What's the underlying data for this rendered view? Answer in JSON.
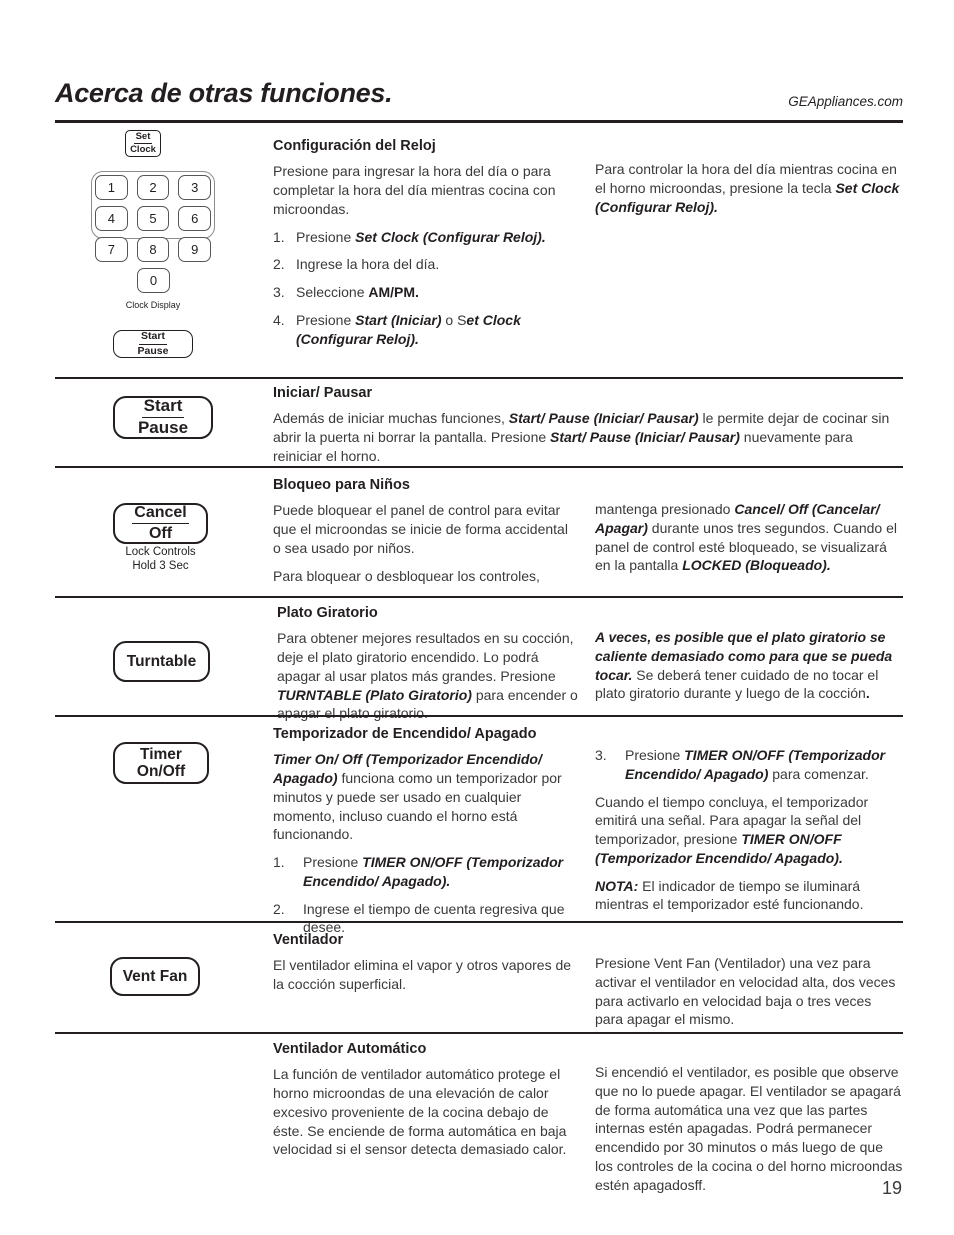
{
  "header": {
    "title": "Acerca de otras funciones.",
    "website": "GEAppliances.com"
  },
  "page_number": "19",
  "control_art": {
    "set_clock_button": "Set\nClock",
    "set_clock_line1": "Set",
    "set_clock_line2": "Clock",
    "keys": [
      "1",
      "2",
      "3",
      "4",
      "5",
      "6",
      "7",
      "8",
      "9",
      "0"
    ],
    "clock_display_label": "Clock Display",
    "start_pause_small_line1": "Start",
    "start_pause_small_line2": "Pause",
    "start_pause_line1": "Start",
    "start_pause_line2": "Pause",
    "cancel_off_line1": "Cancel",
    "cancel_off_line2": "Off",
    "cancel_off_sub_line1": "Lock Controls",
    "cancel_off_sub_line2": "Hold 3 Sec",
    "turntable_label": "Turntable",
    "timer_line1": "Timer",
    "timer_line2": "On/Off",
    "vent_fan_label": "Vent Fan"
  },
  "sections": {
    "clock": {
      "heading": "Configuración del Reloj",
      "intro": "Presione para ingresar la hora del día o para completar la hora del día mientras cocina con microondas.",
      "steps": [
        {
          "num": "1.",
          "pre": "Presione ",
          "bold": "Set Clock (Configurar Reloj).",
          "post": ""
        },
        {
          "num": "2.",
          "pre": "Ingrese la hora del día.",
          "bold": "",
          "post": ""
        },
        {
          "num": "3.",
          "pre": "Seleccione  ",
          "bold": "AM/PM.",
          "post": ""
        },
        {
          "num": "4.",
          "pre": "Presione ",
          "bold": "Start (Iniciar)",
          "post": " o S",
          "bold2": "et Clock (Configurar Reloj)."
        }
      ],
      "right_pre": "Para controlar la hora del día mientras cocina en el horno microondas, presione la tecla ",
      "right_bold": "Set Clock (Configurar Reloj)."
    },
    "start_pause": {
      "heading": "Iniciar/ Pausar",
      "body_1": "Además de iniciar muchas funciones, ",
      "body_b1": "Start/ Pause (Iniciar/ Pausar)",
      "body_2": " le permite dejar de cocinar sin abrir la puerta ni borrar la pantalla. Presione ",
      "body_b2": "Start/ Pause (Iniciar/ Pausar)",
      "body_3": " nuevamente para reiniciar el horno."
    },
    "child_lock": {
      "heading": "Bloqueo para Niños",
      "left_p1": "Puede bloquear el panel de control para evitar que el microondas se inicie de forma accidental o sea usado por niños.",
      "left_p2": "Para bloquear o desbloquear los controles,",
      "right_1": "mantenga presionado ",
      "right_b1": "Cancel/ Off (Cancelar/ Apagar)",
      "right_2": " durante unos tres segundos. Cuando el panel de control esté bloqueado, se visualizará en la pantalla ",
      "right_b2": "LOCKED (Bloqueado)."
    },
    "turntable": {
      "heading": "Plato Giratorio",
      "left_1": "Para obtener mejores resultados en su cocción, deje el plato giratorio encendido. Lo podrá apagar al usar platos más grandes. Presione ",
      "left_b1": "TURNTABLE (Plato Giratorio)",
      "left_2": " para encender o apagar el plato giratorio.",
      "right_b1": "A veces, es posible que el plato giratorio se caliente demasiado como para que se pueda tocar.",
      "right_1": " Se deberá tener cuidado de no tocar el plato giratorio durante y luego de la cocción",
      "right_2": "."
    },
    "timer": {
      "heading": "Temporizador de Encendido/ Apagado",
      "left_b1": "Timer On/ Off (Temporizador Encendido/ Apagado)",
      "left_1": " funciona como un temporizador por minutos y puede ser usado en cualquier momento, incluso cuando el horno está funcionando.",
      "steps": [
        {
          "num": "1.",
          "pre": "Presione ",
          "bold": "TIMER ON/OFF (Temporizador Encendido/ Apagado).",
          "post": ""
        },
        {
          "num": "2.",
          "pre": "Ingrese el tiempo de cuenta regresiva que desee.",
          "bold": "",
          "post": ""
        }
      ],
      "right_step": {
        "num": "3.",
        "pre": "Presione ",
        "bold": "TIMER ON/OFF (Temporizador Encendido/ Apagado)",
        "post": " para comenzar."
      },
      "right_p1": "Cuando el tiempo concluya, el temporizador emitirá una señal. Para apagar la señal del temporizador, presione ",
      "right_p1_bold": "TIMER ON/OFF (Temporizador Encendido/ Apagado).",
      "right_note_label": "NOTA:",
      "right_note_text": " El indicador de tiempo se iluminará mientras el temporizador esté funcionando."
    },
    "vent_fan": {
      "heading": "Ventilador",
      "left": "El ventilador elimina el vapor y otros vapores de la cocción superficial.",
      "right": "Presione Vent Fan (Ventilador) una vez para activar el ventilador en velocidad alta, dos veces para activarlo en velocidad baja o tres veces para apagar el mismo."
    },
    "auto_fan": {
      "heading": "Ventilador Automático",
      "left": "La función de ventilador automático protege el horno microondas de una elevación de calor excesivo proveniente de la cocina debajo de éste. Se enciende de forma automática en baja velocidad si el sensor detecta demasiado calor.",
      "right": "Si encendió el ventilador, es posible que observe que no lo puede apagar. El ventilador se apagará de forma automática una vez que las partes internas estén apagadas. Podrá permanecer encendido por 30 minutos o más luego de que los controles de la cocina o del horno microondas estén apagadosff."
    }
  }
}
